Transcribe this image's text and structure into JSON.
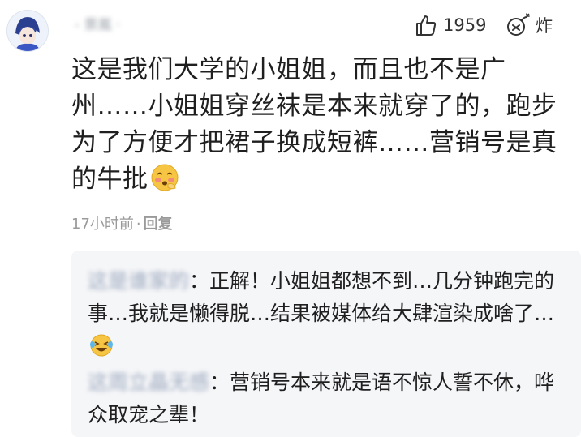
{
  "comment": {
    "username": "-  景嵐  ·",
    "likes": "1959",
    "bomb_label": "炸",
    "text": "这是我们大学的小姐姐，而且也不是广州……小姐姐穿丝袜是本来就穿了的，跑步为了方便才把裙子换成短裤……营销号是真的牛批",
    "time": "17小时前",
    "separator": "·",
    "reply_label": "回复"
  },
  "replies": [
    {
      "user": "这是谁家的",
      "text": "：正解！小姐姐都想不到…几分钟跑完的事…我就是懒得脱…结果被媒体给大肆渲染成啥了…"
    },
    {
      "user": "这周立晶无感",
      "text": "：营销号本来就是语不惊人誓不休，哗众取宠之辈！"
    }
  ],
  "icons": {
    "like": "thumbs-up-icon",
    "bomb": "bomb-icon",
    "emoji_1": "shy-face-emoji",
    "emoji_2": "laughing-tears-emoji"
  },
  "colors": {
    "meta_gray": "#9a9a9a",
    "reply_bg": "#f5f6f8",
    "username_blur": "#9aa7bd"
  }
}
